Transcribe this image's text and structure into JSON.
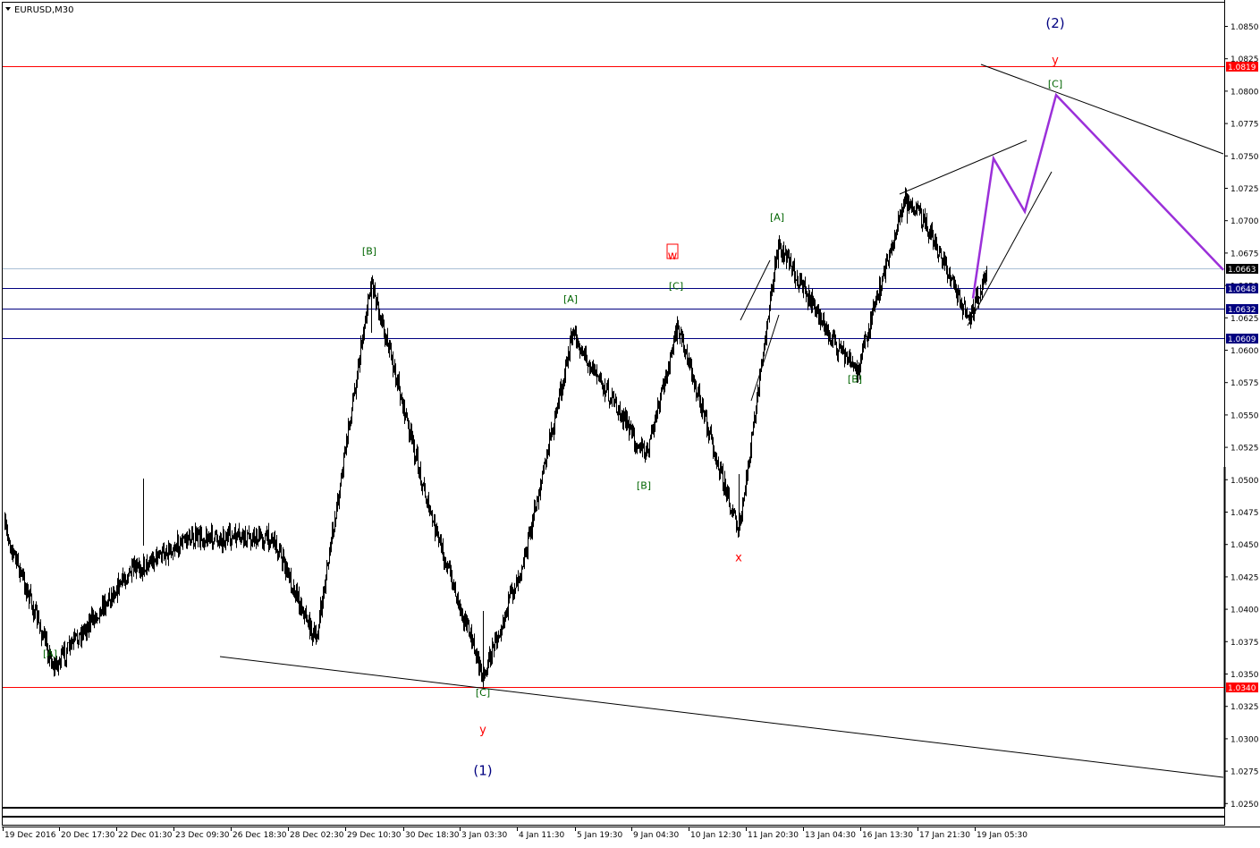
{
  "chart_data": {
    "type": "line",
    "title": "EURUSD,M30",
    "yrange": [
      1.0236,
      1.0866
    ],
    "grid": false,
    "y_ticks": [
      "1.0850",
      "1.0825",
      "1.0800",
      "1.0775",
      "1.0750",
      "1.0725",
      "1.0700",
      "1.0675",
      "1.0650",
      "1.0625",
      "1.0600",
      "1.0575",
      "1.0550",
      "1.0525",
      "1.0500",
      "1.0475",
      "1.0450",
      "1.0425",
      "1.0400",
      "1.0375",
      "1.0350",
      "1.0325",
      "1.0300",
      "1.0275",
      "1.0250"
    ],
    "x_ticks": [
      "19 Dec 2016",
      "20 Dec 17:30",
      "22 Dec 01:30",
      "23 Dec 09:30",
      "26 Dec 18:30",
      "28 Dec 02:30",
      "29 Dec 10:30",
      "30 Dec 18:30",
      "3 Jan 03:30",
      "4 Jan 11:30",
      "5 Jan 19:30",
      "9 Jan 04:30",
      "10 Jan 12:30",
      "11 Jan 20:30",
      "13 Jan 04:30",
      "16 Jan 13:30",
      "17 Jan 21:30",
      "19 Jan 05:30"
    ],
    "price_levels": [
      {
        "label": "1.0819",
        "value": 1.0819,
        "color": "#ff0000",
        "kind": "horizontal"
      },
      {
        "label": "1.0663",
        "value": 1.0663,
        "color": "#a9bfd6",
        "kind": "current"
      },
      {
        "label": "1.0648",
        "value": 1.0648,
        "color": "#000080",
        "kind": "horizontal"
      },
      {
        "label": "1.0632",
        "value": 1.0632,
        "color": "#000080",
        "kind": "horizontal"
      },
      {
        "label": "1.0609",
        "value": 1.0609,
        "color": "#000080",
        "kind": "horizontal"
      },
      {
        "label": "1.0340",
        "value": 1.034,
        "color": "#ff0000",
        "kind": "horizontal"
      }
    ],
    "price_series": [
      {
        "x": "19 Dec 2016",
        "y": 1.0463
      },
      {
        "x": "20 Dec",
        "y": 1.0355
      },
      {
        "x": "22 Dec",
        "y": 1.0425
      },
      {
        "x": "23 Dec",
        "y": 1.0455
      },
      {
        "x": "26 Dec",
        "y": 1.0455
      },
      {
        "x": "28 Dec",
        "y": 1.0375
      },
      {
        "x": "29 Dec",
        "y": 1.0655
      },
      {
        "x": "30 Dec",
        "y": 1.0475
      },
      {
        "x": "3 Jan",
        "y": 1.0348
      },
      {
        "x": "4 Jan",
        "y": 1.0445
      },
      {
        "x": "5 Jan",
        "y": 1.0612
      },
      {
        "x": "9 Jan",
        "y": 1.0518
      },
      {
        "x": "9 Jan",
        "y": 1.0618
      },
      {
        "x": "10 Jan",
        "y": 1.0458
      },
      {
        "x": "11 Jan",
        "y": 1.0683
      },
      {
        "x": "13 Jan",
        "y": 1.0608
      },
      {
        "x": "16 Jan",
        "y": 1.0584
      },
      {
        "x": "16 Jan",
        "y": 1.0718
      },
      {
        "x": "17 Jan",
        "y": 1.0692
      },
      {
        "x": "18 Jan",
        "y": 1.0622
      },
      {
        "x": "19 Jan",
        "y": 1.0664
      }
    ],
    "projection": [
      {
        "x": "19 Jan",
        "y": 1.064
      },
      {
        "x": "projected",
        "y": 1.0748
      },
      {
        "x": "projected",
        "y": 1.0707
      },
      {
        "x": "projected",
        "y": 1.0797
      },
      {
        "x": "projected",
        "y": 1.0662
      }
    ],
    "annotations": [
      {
        "text": "[A]",
        "color": "#006400",
        "price": 1.0363,
        "time": "20 Dec"
      },
      {
        "text": "[B]",
        "color": "#006400",
        "price": 1.0674,
        "time": "29 Dec"
      },
      {
        "text": "[C]",
        "color": "#006400",
        "price": 1.0333,
        "time": "3 Jan"
      },
      {
        "text": "y",
        "color": "#ff0000",
        "price": 1.0304,
        "time": "3 Jan"
      },
      {
        "text": "(1)",
        "color": "#000080",
        "price": 1.0272,
        "time": "3 Jan"
      },
      {
        "text": "[A]",
        "color": "#006400",
        "price": 1.0637,
        "time": "5 Jan"
      },
      {
        "text": "[B]",
        "color": "#006400",
        "price": 1.0493,
        "time": "9 Jan"
      },
      {
        "text": "[C]",
        "color": "#006400",
        "price": 1.0647,
        "time": "9 Jan"
      },
      {
        "text": "w",
        "color": "#ff0000",
        "price": 1.067,
        "time": "9 Jan"
      },
      {
        "text": "x",
        "color": "#ff0000",
        "price": 1.0437,
        "time": "10 Jan"
      },
      {
        "text": "[A]",
        "color": "#006400",
        "price": 1.07,
        "time": "11 Jan"
      },
      {
        "text": "[B]",
        "color": "#006400",
        "price": 1.0575,
        "time": "16 Jan"
      },
      {
        "text": "[C]",
        "color": "#006400",
        "price": 1.0803,
        "time": "19 Jan"
      },
      {
        "text": "y",
        "color": "#ff0000",
        "price": 1.0821,
        "time": "19 Jan"
      },
      {
        "text": "(2)",
        "color": "#000080",
        "price": 1.0849,
        "time": "19 Jan"
      }
    ]
  }
}
